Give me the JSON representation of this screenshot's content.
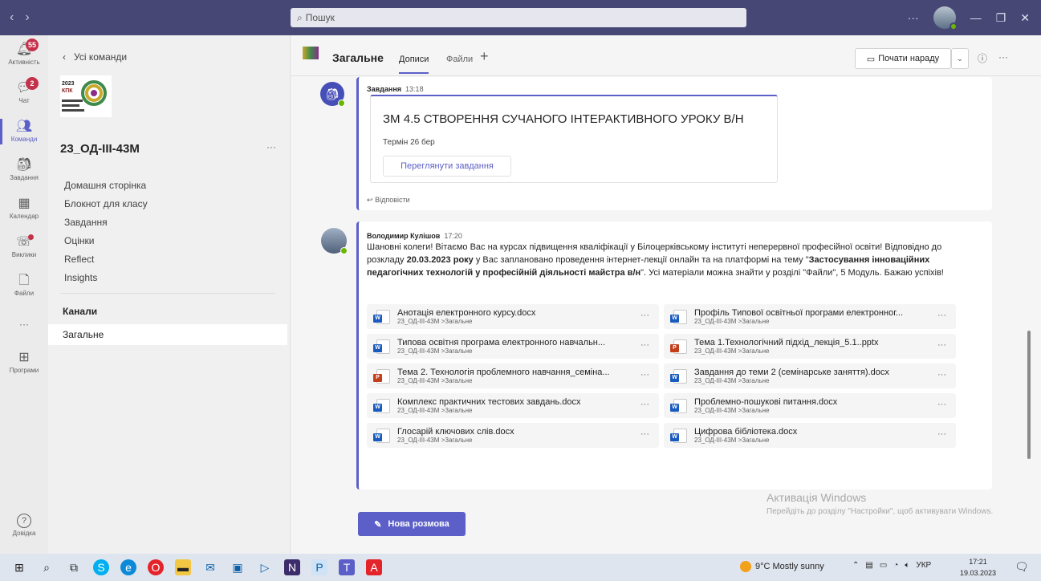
{
  "topbar": {
    "nav_back": "‹",
    "nav_fwd": "›",
    "search_placeholder": "Пошук",
    "more": "···",
    "minimize": "—",
    "maximize": "❐",
    "close": "✕"
  },
  "rail": {
    "items": [
      {
        "label": "Активність",
        "badge": "55",
        "icon": "bell-icon"
      },
      {
        "label": "Чат",
        "badge": "2",
        "icon": "chat-icon"
      },
      {
        "label": "Команди",
        "icon": "teams-icon"
      },
      {
        "label": "Завдання",
        "icon": "backpack-icon"
      },
      {
        "label": "Календар",
        "icon": "calendar-icon"
      },
      {
        "label": "Виклики",
        "icon": "phone-icon"
      },
      {
        "label": "Файли",
        "icon": "file-icon"
      },
      {
        "label": "···",
        "icon": "more-icon"
      },
      {
        "label": "Програми",
        "icon": "apps-icon"
      }
    ],
    "help_label": "Довідка"
  },
  "team": {
    "back_label": "Усі команди",
    "name": "23_ОД-ІІІ-43М",
    "more": "···",
    "links": [
      "Домашня сторінка",
      "Блокнот для класу",
      "Завдання",
      "Оцінки",
      "Reflect",
      "Insights"
    ],
    "channels_heading": "Канали",
    "channel": "Загальне",
    "logo_text": "2023 КПК"
  },
  "channel_header": {
    "title": "Загальне",
    "tab_posts": "Дописи",
    "tab_files": "Файли",
    "plus": "+",
    "meet_label": "Почати нараду",
    "more": "···"
  },
  "assignment_post": {
    "author": "Завдання",
    "time": "13:18",
    "card_title": "ЗМ 4.5 СТВОРЕННЯ СУЧАНОГО ІНТЕРАКТИВНОГО УРОКУ В/Н",
    "due": "Термін 26 бер",
    "view_button": "Переглянути завдання",
    "reply": "Відповісти"
  },
  "message_post": {
    "author": "Володимир Кулішов",
    "time": "17:20",
    "text_1": "Шановні колеги! Вітаємо Вас на курсах підвищення кваліфікації у Білоцерківському інституті неперервної професійної освіти! Відповідно до розкладу ",
    "text_bold_date": "20.03.2023 року",
    "text_2": " у Вас заплановано проведення інтернет-лекції онлайн та на платформі на тему \"",
    "text_bold_topic": "Застосування інноваційних педагогічних технологій у професійній діяльності майстра в/н",
    "text_3": "\". Усі матеріали можна знайти у розділі \"Файли\", 5 Модуль. Бажаю успіхів!",
    "attachments": [
      {
        "name": "Анотація електронного курсу.docx",
        "path": "23_ОД-ІІІ-43М >Загальне",
        "type": "word"
      },
      {
        "name": "Профіль Типової освітньої програми електронног...",
        "path": "23_ОД-ІІІ-43М >Загальне",
        "type": "word"
      },
      {
        "name": "Типова освітня програма електронного навчальн...",
        "path": "23_ОД-ІІІ-43М >Загальне",
        "type": "word"
      },
      {
        "name": "Тема 1.Технологічний підхід_лекція_5.1..pptx",
        "path": "23_ОД-ІІІ-43М >Загальне",
        "type": "ppt"
      },
      {
        "name": "Тема 2. Технологія проблемного навчання_семіна...",
        "path": "23_ОД-ІІІ-43М >Загальне",
        "type": "ppt"
      },
      {
        "name": "Завдання до теми 2 (семінарське заняття).docx",
        "path": "23_ОД-ІІІ-43М >Загальне",
        "type": "word"
      },
      {
        "name": "Комплекс практичних тестових завдань.docx",
        "path": "23_ОД-ІІІ-43М >Загальне",
        "type": "word"
      },
      {
        "name": "Проблемно-пошукові питання.docx",
        "path": "23_ОД-ІІІ-43М >Загальне",
        "type": "word"
      },
      {
        "name": "Глосарій ключових слів.docx",
        "path": "23_ОД-ІІІ-43М >Загальне",
        "type": "word"
      },
      {
        "name": "Цифрова бібліотека.docx",
        "path": "23_ОД-ІІІ-43М >Загальне",
        "type": "word"
      }
    ]
  },
  "new_conversation": "Нова розмова",
  "activation": {
    "title": "Активація Windows",
    "subtitle": "Перейдіть до розділу \"Настройки\", щоб активувати Windows."
  },
  "taskbar": {
    "weather": "9°C  Mostly sunny",
    "lang": "УКР",
    "time": "17:21",
    "date": "19.03.2023"
  },
  "colors": {
    "accent": "#5b5fc7",
    "topbar": "#464775",
    "badge": "#c4314b",
    "presence": "#6bb700"
  }
}
